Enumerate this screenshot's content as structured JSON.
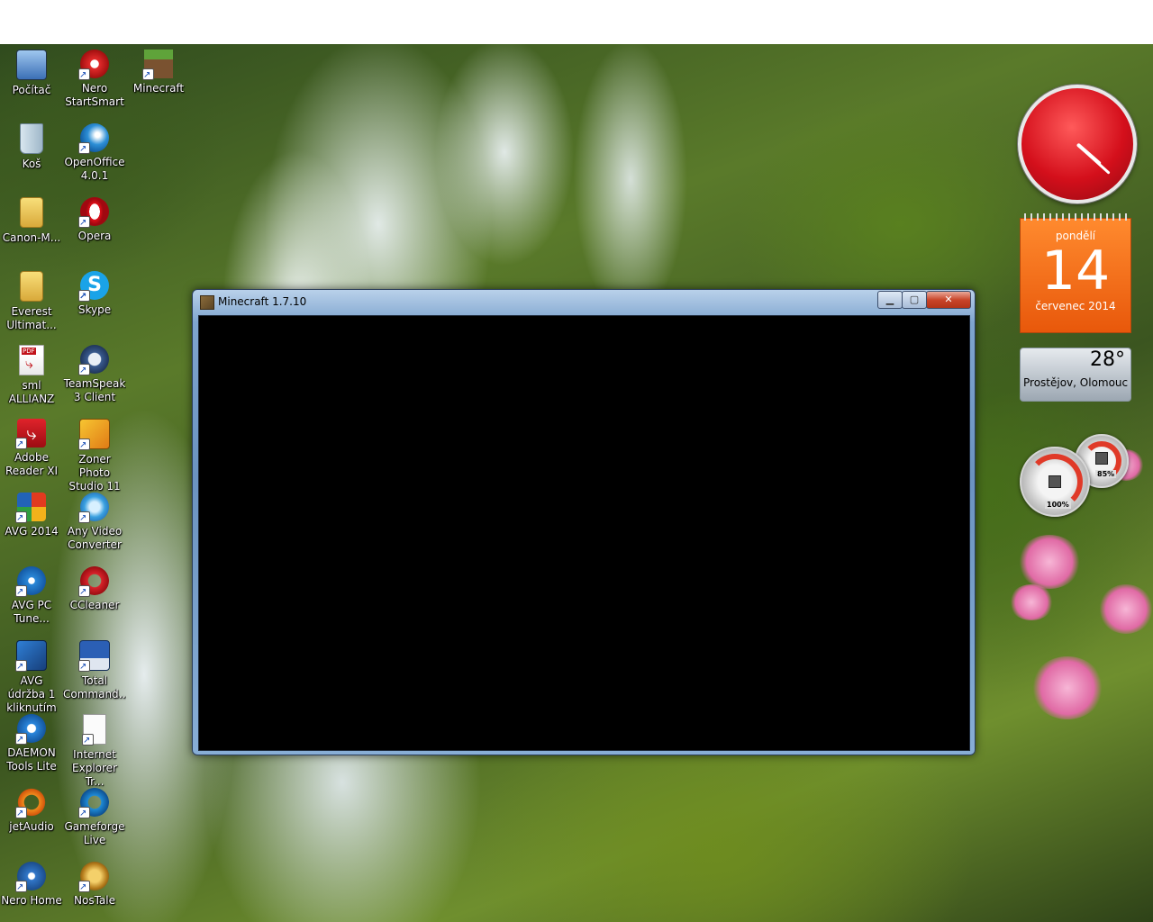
{
  "desktop_icons": [
    {
      "id": "pocitac",
      "label": "Počítač",
      "icon": "computer-icon"
    },
    {
      "id": "nero-startsmart",
      "label": "Nero StartSmart",
      "icon": "nero-icon"
    },
    {
      "id": "minecraft",
      "label": "Minecraft",
      "icon": "minecraft-icon"
    },
    {
      "id": "kos",
      "label": "Koš",
      "icon": "recycle-bin-icon"
    },
    {
      "id": "openoffice",
      "label": "OpenOffice 4.0.1",
      "icon": "openoffice-icon"
    },
    {
      "id": "canon",
      "label": "Canon-M...",
      "icon": "folder-icon"
    },
    {
      "id": "opera",
      "label": "Opera",
      "icon": "opera-icon"
    },
    {
      "id": "everest",
      "label": "Everest Ultimat...",
      "icon": "folder-icon"
    },
    {
      "id": "skype",
      "label": "Skype",
      "icon": "skype-icon"
    },
    {
      "id": "sml-allianz",
      "label": "sml ALLIANZ",
      "icon": "pdf-icon"
    },
    {
      "id": "teamspeak",
      "label": "TeamSpeak 3 Client",
      "icon": "teamspeak-icon"
    },
    {
      "id": "adobe-reader",
      "label": "Adobe Reader XI",
      "icon": "adobe-reader-icon"
    },
    {
      "id": "zoner",
      "label": "Zoner Photo Studio 11",
      "icon": "zoner-icon"
    },
    {
      "id": "avg2014",
      "label": "AVG 2014",
      "icon": "avg-icon"
    },
    {
      "id": "any-video",
      "label": "Any Video Converter",
      "icon": "video-converter-icon"
    },
    {
      "id": "avg-pc-tune",
      "label": "AVG PC Tune...",
      "icon": "avg-tune-icon"
    },
    {
      "id": "ccleaner",
      "label": "CCleaner",
      "icon": "ccleaner-icon"
    },
    {
      "id": "avg-udrzba",
      "label": "AVG údržba 1 kliknutím",
      "icon": "avg-maintenance-icon"
    },
    {
      "id": "total-commander",
      "label": "Total Command...",
      "icon": "total-commander-icon"
    },
    {
      "id": "daemon",
      "label": "DAEMON Tools Lite",
      "icon": "daemon-tools-icon"
    },
    {
      "id": "ie",
      "label": "Internet Explorer Tr...",
      "icon": "document-icon"
    },
    {
      "id": "jetaudio",
      "label": "jetAudio",
      "icon": "jetaudio-icon"
    },
    {
      "id": "gameforge",
      "label": "Gameforge Live",
      "icon": "gameforge-icon"
    },
    {
      "id": "nero-home",
      "label": "Nero Home",
      "icon": "nero-home-icon"
    },
    {
      "id": "nostale",
      "label": "NosTale",
      "icon": "nostale-icon"
    }
  ],
  "window": {
    "title": "Minecraft 1.7.10",
    "minimize_glyph": "▁",
    "maximize_glyph": "▢",
    "close_glyph": "✕"
  },
  "gadgets": {
    "clock": {
      "hour": 4,
      "minute": 22,
      "face_color": "#d40f1b"
    },
    "calendar": {
      "day_name": "pondělí",
      "day": "14",
      "month_year": "červenec 2014",
      "color": "#e8580b"
    },
    "weather": {
      "temperature": "28°",
      "location": "Prostějov, Olomouc..."
    },
    "cpu_meter": {
      "cpu": "100%",
      "memory": "85%"
    }
  }
}
